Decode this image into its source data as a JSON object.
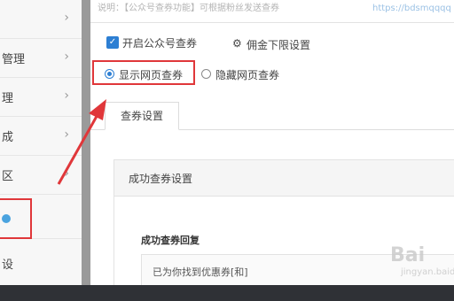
{
  "sidebar": {
    "items": [
      {
        "label": "",
        "chevron": "›"
      },
      {
        "label": "管理",
        "chevron": "›"
      },
      {
        "label": "理",
        "chevron": "›"
      },
      {
        "label": "成",
        "chevron": "›"
      },
      {
        "label": "区",
        "chevron": "›"
      },
      {
        "label": "",
        "chevron": ""
      },
      {
        "label": "设",
        "chevron": ""
      }
    ]
  },
  "top_note": {
    "text": "说明：【公众号查券功能】可根据粉丝发送查券",
    "link": "https://bdsmqqqq"
  },
  "options": {
    "enable_label": "开启公众号查券",
    "commission_label": "佣金下限设置",
    "radio_show": "显示网页查券",
    "radio_hide": "隐藏网页查券"
  },
  "tabs": [
    "查券设置"
  ],
  "panel": {
    "title": "成功查券设置",
    "section_title": "成功查券回复",
    "reply_text": "已为你找到优惠券[和]"
  },
  "watermark": {
    "main": "Bai",
    "sub": "jingyan.baidu"
  },
  "colors": {
    "accent": "#2d7fd3",
    "highlight": "#e0373a"
  }
}
